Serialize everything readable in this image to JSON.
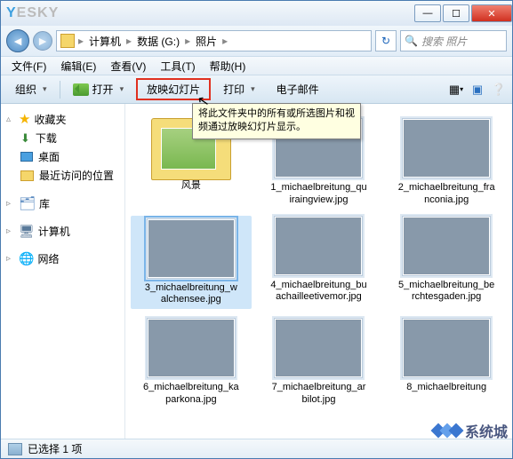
{
  "titlebar": {
    "logo1": "Y",
    "logo2": "ESKY"
  },
  "address": {
    "seg1": "计算机",
    "seg2": "数据 (G:)",
    "seg3": "照片",
    "search_placeholder": "搜索 照片"
  },
  "menubar": {
    "file": "文件(F)",
    "edit": "编辑(E)",
    "view": "查看(V)",
    "tools": "工具(T)",
    "help": "帮助(H)"
  },
  "toolbar": {
    "organize": "组织",
    "open": "打开",
    "slideshow": "放映幻灯片",
    "print": "打印",
    "email": "电子邮件"
  },
  "tooltip": {
    "text": "将此文件夹中的所有或所选图片和视频通过放映幻灯片显示。"
  },
  "sidebar": {
    "favorites": "收藏夹",
    "downloads": "下载",
    "desktop": "桌面",
    "recent": "最近访问的位置",
    "libraries": "库",
    "computer": "计算机",
    "network": "网络"
  },
  "files": [
    {
      "name": "风景",
      "type": "folder"
    },
    {
      "name": "1_michaelbreitung_quiraingview.jpg",
      "cls": "p1"
    },
    {
      "name": "2_michaelbreitung_franconia.jpg",
      "cls": "p2"
    },
    {
      "name": "3_michaelbreitung_walchensee.jpg",
      "cls": "p3",
      "selected": true
    },
    {
      "name": "4_michaelbreitung_buachailleetivemor.jpg",
      "cls": "p4"
    },
    {
      "name": "5_michaelbreitung_berchtesgaden.jpg",
      "cls": "p5"
    },
    {
      "name": "6_michaelbreitung_kaparkona.jpg",
      "cls": "p6"
    },
    {
      "name": "7_michaelbreitung_arbilot.jpg",
      "cls": "p7"
    },
    {
      "name": "8_michaelbreitung",
      "cls": "p8"
    }
  ],
  "statusbar": {
    "text": "已选择 1 项"
  },
  "watermark": {
    "text": "系统城"
  }
}
